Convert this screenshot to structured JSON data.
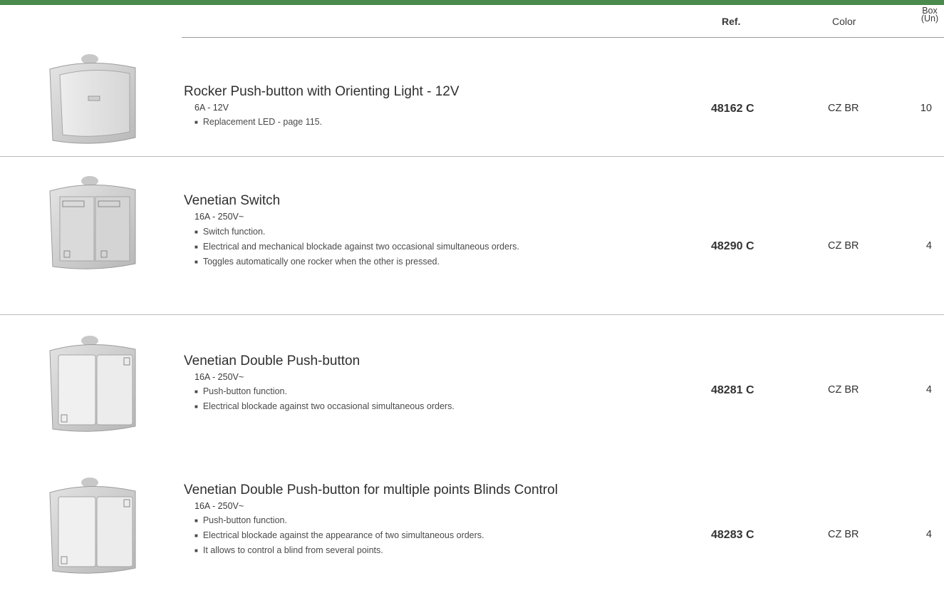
{
  "header": {
    "ref": "Ref.",
    "color": "Color",
    "box_line1": "Box",
    "box_line2": "(Un)"
  },
  "products": [
    {
      "icon": "single-rocker-switch-image",
      "title": "Rocker Push-button with Orienting Light - 12V",
      "spec": "6A - 12V",
      "bullets": [
        "Replacement LED - page 115."
      ],
      "ref": "48162 C",
      "color": "CZ BR",
      "box": "10"
    },
    {
      "icon": "double-rocker-switch-image",
      "title": "Venetian Switch",
      "spec": "16A - 250V~",
      "bullets": [
        "Switch function.",
        "Electrical and mechanical blockade against two occasional simultaneous orders.",
        "Toggles automatically one rocker when the other is pressed."
      ],
      "ref": "48290 C",
      "color": "CZ BR",
      "box": "4"
    },
    {
      "icon": "double-push-button-image",
      "title": "Venetian Double Push-button",
      "spec": "16A - 250V~",
      "bullets": [
        "Push-button function.",
        "Electrical blockade against two occasional simultaneous orders."
      ],
      "ref": "48281 C",
      "color": "CZ BR",
      "box": "4"
    },
    {
      "icon": "double-push-button-image",
      "title": "Venetian Double Push-button for multiple points Blinds Control",
      "spec": "16A - 250V~",
      "bullets": [
        "Push-button function.",
        "Electrical blockade against the appearance of two simultaneous orders.",
        "It allows to control a blind from several points."
      ],
      "ref": "48283 C",
      "color": "CZ BR",
      "box": "4"
    }
  ]
}
